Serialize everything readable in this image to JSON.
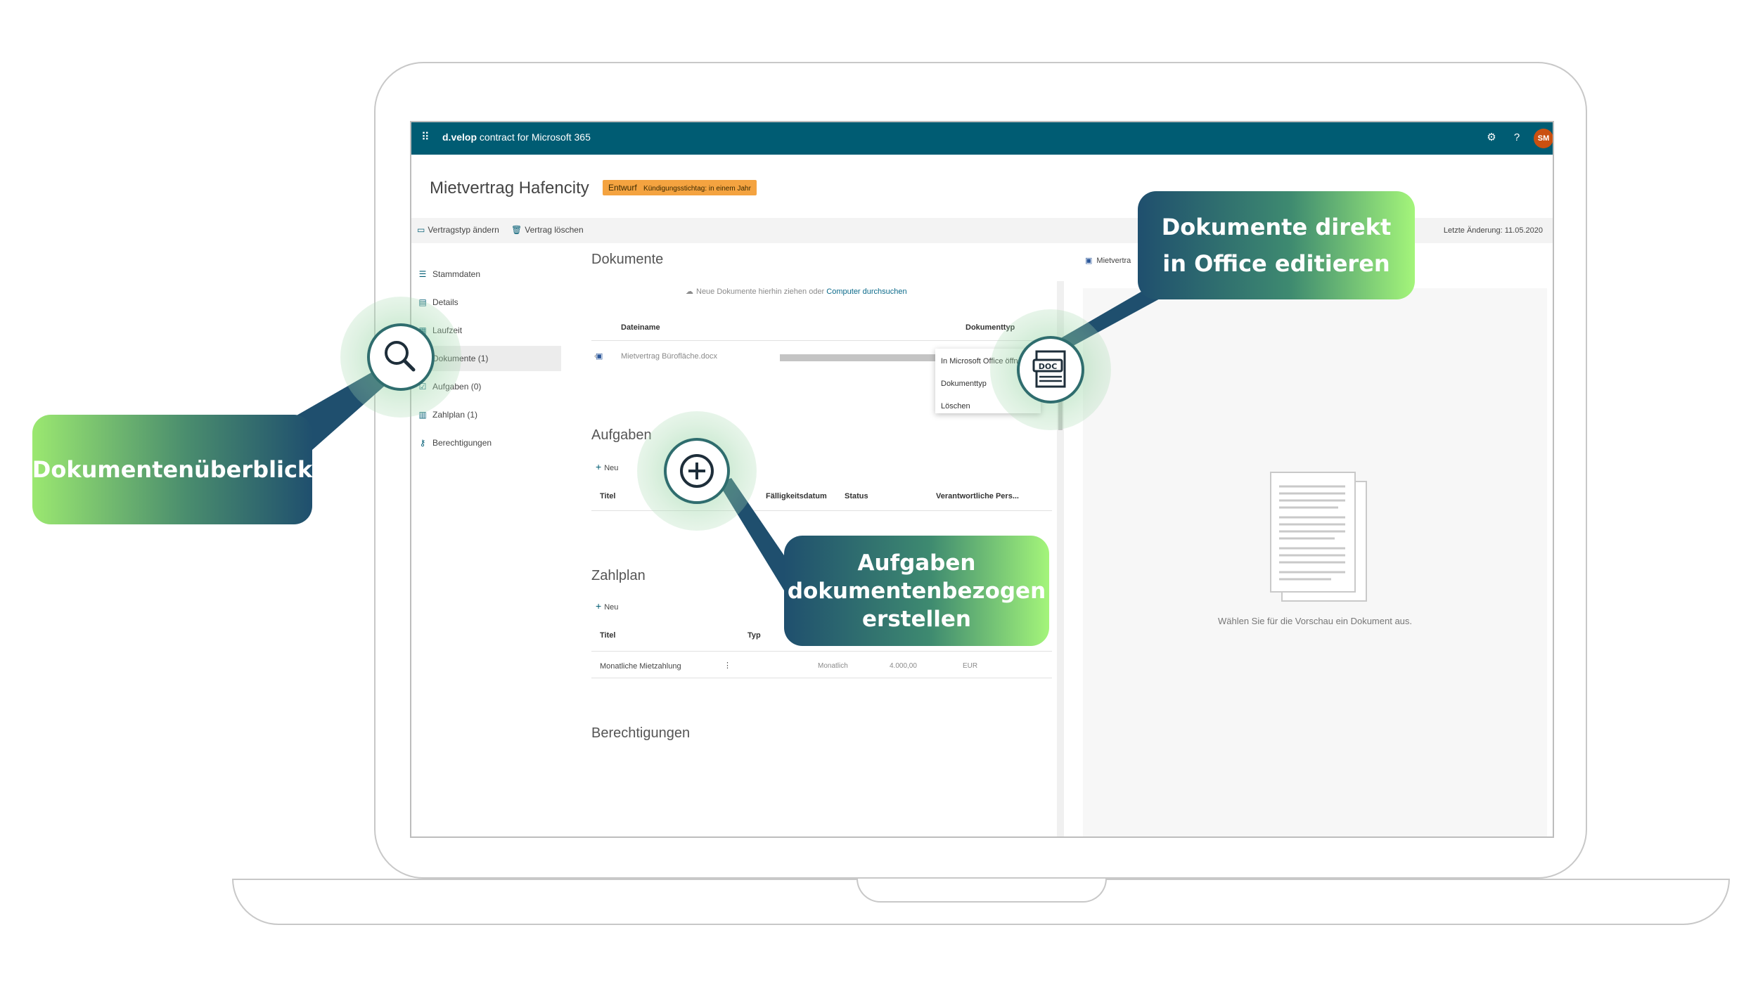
{
  "app": {
    "brand": "d.velop",
    "product": "contract for Microsoft 365",
    "avatar_initials": "SM"
  },
  "contract": {
    "title": "Mietvertrag Hafencity",
    "status": "Entwurf",
    "notice": "Kündigungsstichtag: in einem Jahr"
  },
  "commands": {
    "change_type": "Vertragstyp ändern",
    "delete": "Vertrag löschen",
    "last_change": "Letzte Änderung: 11.05.2020"
  },
  "nav": {
    "items": [
      {
        "label": "Stammdaten",
        "icon": "list-icon"
      },
      {
        "label": "Details",
        "icon": "document-icon"
      },
      {
        "label": "Laufzeit",
        "icon": "calendar-icon"
      },
      {
        "label": "Dokumente (1)",
        "icon": "document-icon"
      },
      {
        "label": "Aufgaben (0)",
        "icon": "task-icon"
      },
      {
        "label": "Zahlplan (1)",
        "icon": "payment-icon"
      },
      {
        "label": "Berechtigungen",
        "icon": "key-icon"
      }
    ]
  },
  "documents": {
    "title": "Dokumente",
    "drop_text": "Neue Dokumente hierhin ziehen oder",
    "browse_link": "Computer durchsuchen",
    "col_name": "Dateiname",
    "col_type": "Dokumenttyp",
    "file": "Mietvertrag Bürofläche.docx",
    "menu": [
      "In Microsoft Office öffnen",
      "Dokumenttyp",
      "Löschen"
    ]
  },
  "tasks": {
    "title": "Aufgaben",
    "new": "Neu",
    "cols": [
      "Titel",
      "Fälligkeitsdatum",
      "Status",
      "Verantwortliche Pers..."
    ]
  },
  "payment": {
    "title": "Zahlplan",
    "new": "Neu",
    "cols": [
      "Titel",
      "Typ"
    ],
    "row": {
      "title": "Monatliche Mietzahlung",
      "interval": "Monatlich",
      "amount": "4.000,00",
      "currency": "EUR"
    }
  },
  "permissions": {
    "title": "Berechtigungen"
  },
  "preview": {
    "tab": "Mietvertra",
    "empty": "Wählen Sie für die Vorschau ein Dokument aus."
  },
  "callouts": {
    "overview": "Dokumentenüberblick",
    "office_line1": "Dokumente direkt",
    "office_line2": "in Office editieren",
    "tasks_line1": "Aufgaben",
    "tasks_line2": "dokumentenbezogen",
    "tasks_line3": "erstellen",
    "doc_icon_label": "DOC"
  },
  "colors": {
    "topbar": "#005c73",
    "badge": "#f4a340",
    "avatar": "#ca5010",
    "callout_dark": "#1f4f6e",
    "callout_light": "#a4f57a"
  }
}
